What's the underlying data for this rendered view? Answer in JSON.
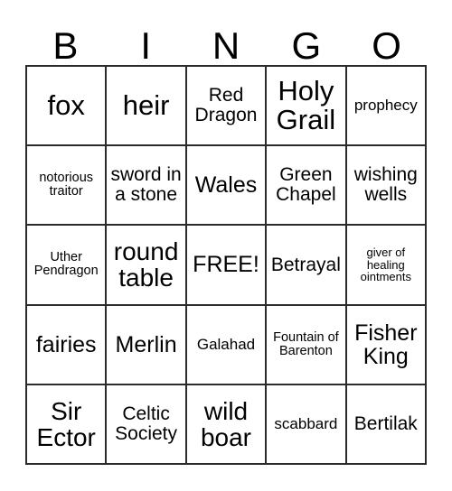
{
  "card": {
    "headers": [
      "B",
      "I",
      "N",
      "G",
      "O"
    ],
    "free_space_label": "FREE!",
    "rows": [
      [
        {
          "text": "fox",
          "size": "fs-xxl"
        },
        {
          "text": "heir",
          "size": "fs-xxl"
        },
        {
          "text": "Red Dragon",
          "size": "fs-md"
        },
        {
          "text": "Holy Grail",
          "size": "fs-xxl"
        },
        {
          "text": "prophecy",
          "size": "fs-sm"
        }
      ],
      [
        {
          "text": "notorious traitor",
          "size": "fs-xs"
        },
        {
          "text": "sword in a stone",
          "size": "fs-md"
        },
        {
          "text": "Wales",
          "size": "fs-lg"
        },
        {
          "text": "Green Chapel",
          "size": "fs-md"
        },
        {
          "text": "wishing wells",
          "size": "fs-md"
        }
      ],
      [
        {
          "text": "Uther Pendragon",
          "size": "fs-xs"
        },
        {
          "text": "round table",
          "size": "fs-xl"
        },
        {
          "text": "FREE!",
          "size": "fs-lg"
        },
        {
          "text": "Betrayal",
          "size": "fs-md"
        },
        {
          "text": "giver of healing ointments",
          "size": "fs-xxs"
        }
      ],
      [
        {
          "text": "fairies",
          "size": "fs-lg"
        },
        {
          "text": "Merlin",
          "size": "fs-lg"
        },
        {
          "text": "Galahad",
          "size": "fs-sm"
        },
        {
          "text": "Fountain of Barenton",
          "size": "fs-xs"
        },
        {
          "text": "Fisher King",
          "size": "fs-lg"
        }
      ],
      [
        {
          "text": "Sir Ector",
          "size": "fs-xl"
        },
        {
          "text": "Celtic Society",
          "size": "fs-md"
        },
        {
          "text": "wild boar",
          "size": "fs-xl"
        },
        {
          "text": "scabbard",
          "size": "fs-sm"
        },
        {
          "text": "Bertilak",
          "size": "fs-md"
        }
      ]
    ]
  },
  "colors": {
    "grid_line": "#2b2b2b",
    "text": "#000000",
    "background": "#ffffff"
  }
}
